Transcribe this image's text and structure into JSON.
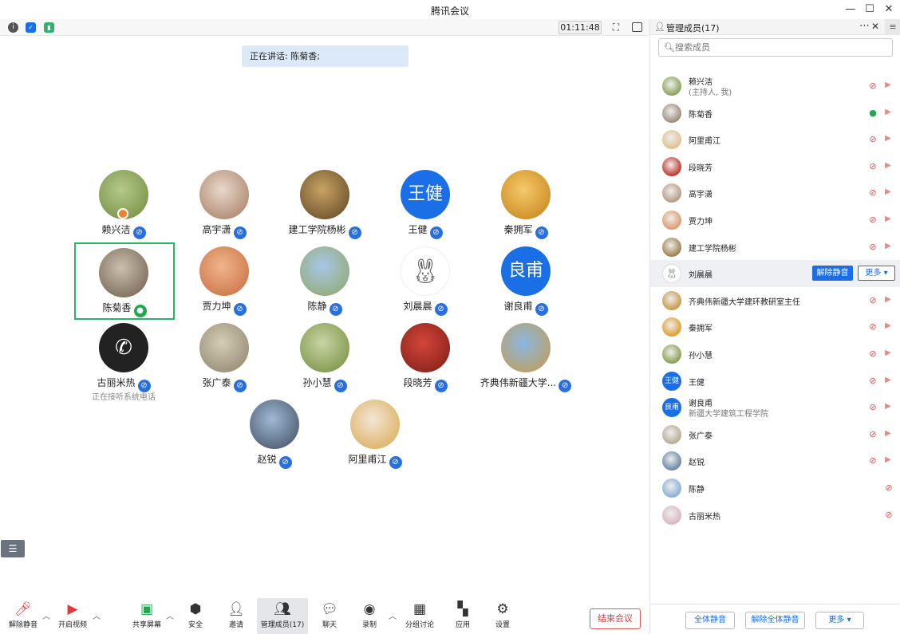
{
  "window": {
    "title": "腾讯会议"
  },
  "top_bar": {
    "timer": "01:11:48"
  },
  "speaking_banner": "正在讲话: 陈菊香;",
  "tiles": [
    {
      "name": "赖兴洁",
      "avatar": "photo",
      "colors": [
        "#b5c98a",
        "#6e8a3c"
      ],
      "host": true
    },
    {
      "name": "高宇潇",
      "avatar": "photo",
      "colors": [
        "#e8d8cc",
        "#a3775c"
      ]
    },
    {
      "name": "建工学院杨彬",
      "avatar": "photo",
      "colors": [
        "#c9a365",
        "#5a4220"
      ]
    },
    {
      "name": "王健",
      "avatar": "text",
      "avatar_text": "王健"
    },
    {
      "name": "秦拥军",
      "avatar": "photo",
      "colors": [
        "#f5c96b",
        "#c47f14"
      ]
    },
    {
      "name": "陈菊香",
      "avatar": "photo",
      "colors": [
        "#cbbfae",
        "#6b5a48"
      ],
      "active": true,
      "speaking": true
    },
    {
      "name": "贾力坤",
      "avatar": "photo",
      "colors": [
        "#f2b48c",
        "#c36b3c"
      ]
    },
    {
      "name": "陈静",
      "avatar": "photo",
      "colors": [
        "#a8c6e8",
        "#8ea861"
      ]
    },
    {
      "name": "刘晨晨",
      "avatar": "rabbit"
    },
    {
      "name": "谢良甫",
      "avatar": "text",
      "avatar_text": "良甫"
    },
    {
      "name": "古丽米热",
      "avatar": "phone",
      "sub": "正在接听系统电话"
    },
    {
      "name": "张广泰",
      "avatar": "photo",
      "colors": [
        "#d6cdb8",
        "#8a8068"
      ]
    },
    {
      "name": "孙小慧",
      "avatar": "photo",
      "colors": [
        "#c9d4a4",
        "#6f8a3a"
      ]
    },
    {
      "name": "段晓芳",
      "avatar": "photo",
      "colors": [
        "#d4453a",
        "#7a1c16"
      ]
    },
    {
      "name": "齐典伟新疆大学...",
      "avatar": "photo",
      "colors": [
        "#8ab8e0",
        "#c99a4a"
      ]
    },
    {
      "name": "赵锐",
      "avatar": "photo",
      "colors": [
        "#9fb9d6",
        "#3d4a5c"
      ]
    },
    {
      "name": "阿里甫江",
      "avatar": "photo",
      "colors": [
        "#f3e6d6",
        "#d8a64a"
      ]
    }
  ],
  "bottom_toolbar": {
    "unmute": "解除静音",
    "video": "开启视频",
    "share": "共享屏幕",
    "security": "安全",
    "invite": "邀请",
    "members": "管理成员(17)",
    "chat": "聊天",
    "record": "录制",
    "breakout": "分组讨论",
    "apps": "应用",
    "settings": "设置",
    "end": "结束会议"
  },
  "panel": {
    "title": "管理成员(17)",
    "search_placeholder": "搜索成员",
    "members": [
      {
        "name": "赖兴洁",
        "sub": "(主持人, 我)",
        "avatar": "photo",
        "color": "#8aa35a",
        "mic": "muted",
        "cam": true
      },
      {
        "name": "陈菊香",
        "avatar": "photo",
        "color": "#9e8e7a",
        "mic": "on",
        "cam": true
      },
      {
        "name": "阿里甫江",
        "avatar": "photo",
        "color": "#e0c090",
        "mic": "muted",
        "cam": true
      },
      {
        "name": "段晓芳",
        "avatar": "photo",
        "color": "#c0392b",
        "mic": "muted",
        "cam": true
      },
      {
        "name": "高宇潇",
        "avatar": "photo",
        "color": "#b89a84",
        "mic": "muted",
        "cam": true
      },
      {
        "name": "贾力坤",
        "avatar": "photo",
        "color": "#e09a6a",
        "mic": "muted",
        "cam": true
      },
      {
        "name": "建工学院杨彬",
        "avatar": "photo",
        "color": "#a0804a",
        "mic": "muted",
        "cam": true
      },
      {
        "name": "刘晨晨",
        "avatar": "rabbit",
        "highlight": true,
        "actions": {
          "unmute": "解除静音",
          "more": "更多 ▾"
        }
      },
      {
        "name": "齐典伟新疆大学建环教研室主任",
        "avatar": "photo",
        "color": "#c99a4a",
        "mic": "muted",
        "cam": true
      },
      {
        "name": "秦拥军",
        "avatar": "photo",
        "color": "#e0a030",
        "mic": "muted",
        "cam": true
      },
      {
        "name": "孙小慧",
        "avatar": "photo",
        "color": "#8aa050",
        "mic": "muted",
        "cam": true
      },
      {
        "name": "王健",
        "avatar": "text",
        "avatar_text": "王健",
        "mic": "muted",
        "cam": true
      },
      {
        "name": "谢良甫",
        "sub": "新疆大学建筑工程学院",
        "avatar": "text",
        "avatar_text": "良甫",
        "mic": "muted",
        "cam": true
      },
      {
        "name": "张广泰",
        "avatar": "photo",
        "color": "#b8ad94",
        "mic": "muted",
        "cam": true
      },
      {
        "name": "赵锐",
        "avatar": "photo",
        "color": "#6c86a8",
        "mic": "muted",
        "cam": true
      },
      {
        "name": "陈静",
        "avatar": "photo",
        "color": "#8ab0d8",
        "mic": "muted",
        "cam": false
      },
      {
        "name": "古丽米热",
        "avatar": "photo",
        "color": "#d8b8c0",
        "mic": "muted",
        "cam": false
      }
    ],
    "footer": {
      "mute_all": "全体静音",
      "unmute_all": "解除全体静音",
      "more": "更多 ▾"
    }
  }
}
